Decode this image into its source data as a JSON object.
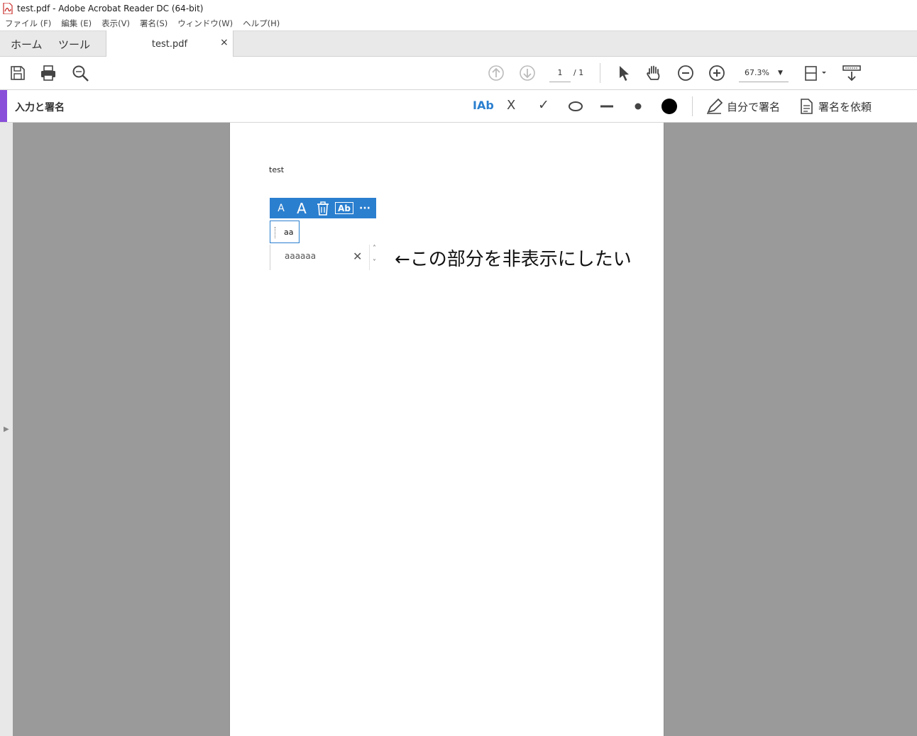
{
  "window": {
    "title": "test.pdf - Adobe Acrobat Reader DC (64-bit)",
    "icon": "pdf-app-icon"
  },
  "menu": {
    "items": [
      "ファイル (F)",
      "編集 (E)",
      "表示(V)",
      "署名(S)",
      "ウィンドウ(W)",
      "ヘルプ(H)"
    ]
  },
  "tabs": {
    "home": "ホーム",
    "tools": "ツール",
    "document": "test.pdf",
    "close": "×"
  },
  "toolbar": {
    "icons": [
      "save-icon",
      "print-icon",
      "search-icon",
      "prev-page-icon",
      "next-page-icon",
      "select-icon",
      "hand-icon",
      "zoom-out-icon",
      "zoom-in-icon",
      "page-fit-icon",
      "scroll-mode-icon"
    ],
    "current_page": "1",
    "page_total": "/ 1",
    "zoom": "67.3%",
    "zoom_caret": "▼"
  },
  "sign_bar": {
    "title": "入力と署名",
    "text_tool": "IAb",
    "cross_tool": "X",
    "check_tool": "✓",
    "self_sign": "自分で署名",
    "request_sign": "署名を依頼",
    "accent_color": "#8a4fd9",
    "tool_color": "#2b7fcf"
  },
  "document": {
    "body_text": "test",
    "field_toolbar": {
      "small_font": "A",
      "large_font": "A",
      "comb": "Ab",
      "more": "···"
    },
    "field_value": "aa",
    "autocomplete_value": "aaaaaa",
    "clear": "✕",
    "scroll_up": "˄",
    "scroll_down": "˅",
    "annotation": "←この部分を非表示にしたい"
  },
  "rail": {
    "arrow": "▶"
  }
}
